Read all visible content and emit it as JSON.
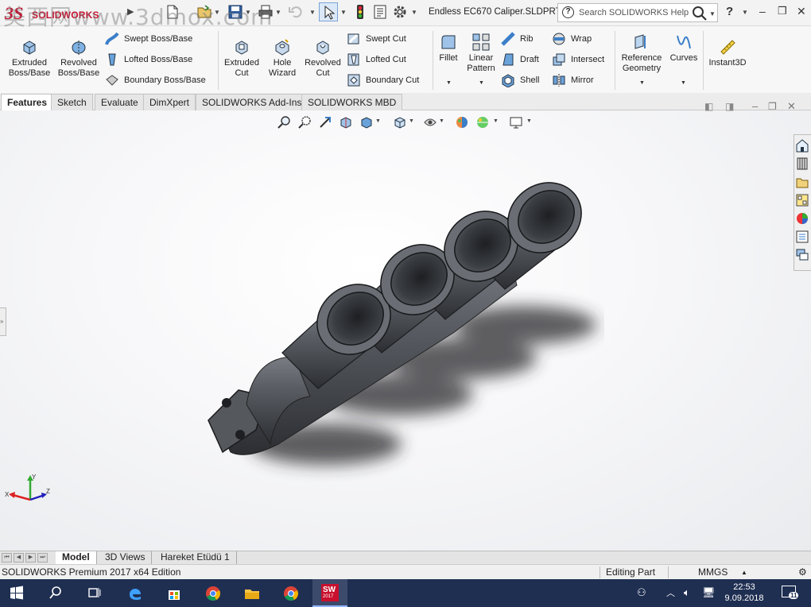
{
  "app": {
    "name": "SOLIDWORKS",
    "document_title": "Endless EC670 Caliper.SLDPRT",
    "watermark": "美西网www.3dmox.com"
  },
  "search": {
    "placeholder": "Search SOLIDWORKS Help"
  },
  "ribbon": {
    "extruded_boss": "Extruded Boss/Base",
    "revolved_boss": "Revolved Boss/Base",
    "swept_boss": "Swept Boss/Base",
    "lofted_boss": "Lofted Boss/Base",
    "boundary_boss": "Boundary Boss/Base",
    "extruded_cut": "Extruded Cut",
    "hole_wizard": "Hole Wizard",
    "revolved_cut": "Revolved Cut",
    "swept_cut": "Swept Cut",
    "lofted_cut": "Lofted Cut",
    "boundary_cut": "Boundary Cut",
    "fillet": "Fillet",
    "linear_pattern": "Linear Pattern",
    "rib": "Rib",
    "draft": "Draft",
    "shell": "Shell",
    "wrap": "Wrap",
    "intersect": "Intersect",
    "mirror": "Mirror",
    "reference_geometry": "Reference Geometry",
    "curves": "Curves",
    "instant3d": "Instant3D"
  },
  "tabs": [
    "Features",
    "Sketch",
    "Evaluate",
    "DimXpert",
    "SOLIDWORKS Add-Ins",
    "SOLIDWORKS MBD"
  ],
  "bottom_tabs": [
    "Model",
    "3D Views",
    "Hareket Etüdü 1"
  ],
  "status": {
    "edition": "SOLIDWORKS Premium 2017 x64 Edition",
    "mode": "Editing Part",
    "units": "MMGS"
  },
  "clock": {
    "time": "22:53",
    "date": "9.09.2018"
  },
  "notifications": {
    "count": "11"
  },
  "taskbar": {
    "sw_badge": "2017"
  },
  "colors": {
    "accent": "#c8102e",
    "taskbar": "#1f2f52",
    "part": "#4a4d52"
  }
}
